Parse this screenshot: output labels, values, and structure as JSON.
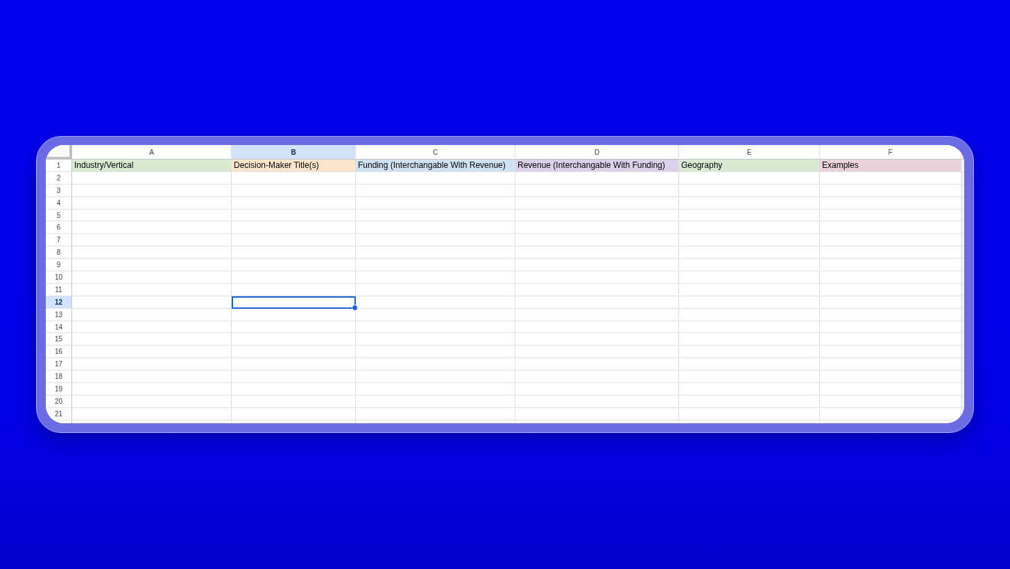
{
  "columns": [
    {
      "label": "A",
      "selected": false
    },
    {
      "label": "B",
      "selected": true
    },
    {
      "label": "C",
      "selected": false
    },
    {
      "label": "D",
      "selected": false
    },
    {
      "label": "E",
      "selected": false
    },
    {
      "label": "F",
      "selected": false
    }
  ],
  "rows": [
    {
      "number": "1",
      "selected": false,
      "cells": [
        {
          "text": "Industry/Vertical",
          "color": "#d9ead3"
        },
        {
          "text": "Decision-Maker Title(s)",
          "color": "#fce5cd"
        },
        {
          "text": "Funding (Interchangable With Revenue)",
          "color": "#cfe2f3"
        },
        {
          "text": "Revenue (Interchangable With Funding)",
          "color": "#d9d2e9"
        },
        {
          "text": "Geography",
          "color": "#d9ead3"
        },
        {
          "text": "Examples",
          "color": "#ead1dc"
        }
      ]
    },
    {
      "number": "2",
      "selected": false
    },
    {
      "number": "3",
      "selected": false
    },
    {
      "number": "4",
      "selected": false
    },
    {
      "number": "5",
      "selected": false
    },
    {
      "number": "6",
      "selected": false
    },
    {
      "number": "7",
      "selected": false
    },
    {
      "number": "8",
      "selected": false
    },
    {
      "number": "9",
      "selected": false
    },
    {
      "number": "10",
      "selected": false
    },
    {
      "number": "11",
      "selected": false
    },
    {
      "number": "12",
      "selected": true
    },
    {
      "number": "13",
      "selected": false
    },
    {
      "number": "14",
      "selected": false
    },
    {
      "number": "15",
      "selected": false
    },
    {
      "number": "16",
      "selected": false
    },
    {
      "number": "17",
      "selected": false
    },
    {
      "number": "18",
      "selected": false
    },
    {
      "number": "19",
      "selected": false
    },
    {
      "number": "20",
      "selected": false
    },
    {
      "number": "21",
      "selected": false
    }
  ]
}
